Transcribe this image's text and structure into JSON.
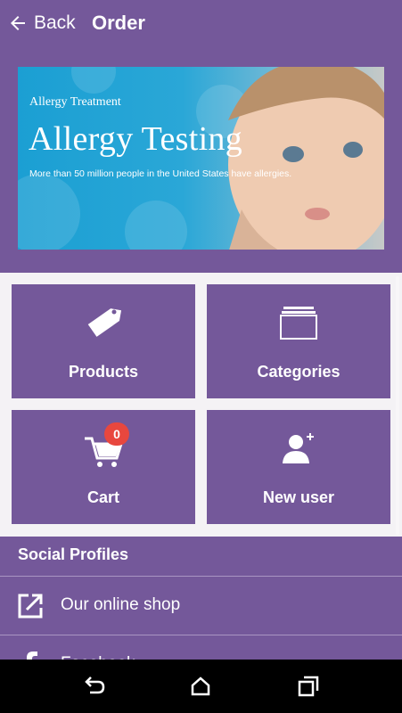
{
  "header": {
    "back_label": "Back",
    "title": "Order"
  },
  "banner": {
    "subtitle": "Allergy Treatment",
    "headline": "Allergy Testing",
    "description": "More than 50 million people in the United States have allergies."
  },
  "tiles": [
    {
      "label": "Products",
      "icon": "tag-icon"
    },
    {
      "label": "Categories",
      "icon": "folders-icon"
    },
    {
      "label": "Cart",
      "icon": "cart-icon",
      "badge": "0"
    },
    {
      "label": "New user",
      "icon": "add-user-icon"
    }
  ],
  "social": {
    "title": "Social Profiles",
    "items": [
      {
        "label": "Our online shop",
        "icon": "external-link-icon"
      },
      {
        "label": "Facebook",
        "icon": "facebook-icon"
      }
    ]
  },
  "colors": {
    "primary": "#74589a",
    "badge": "#e8473e",
    "background": "#f4f2f5"
  }
}
